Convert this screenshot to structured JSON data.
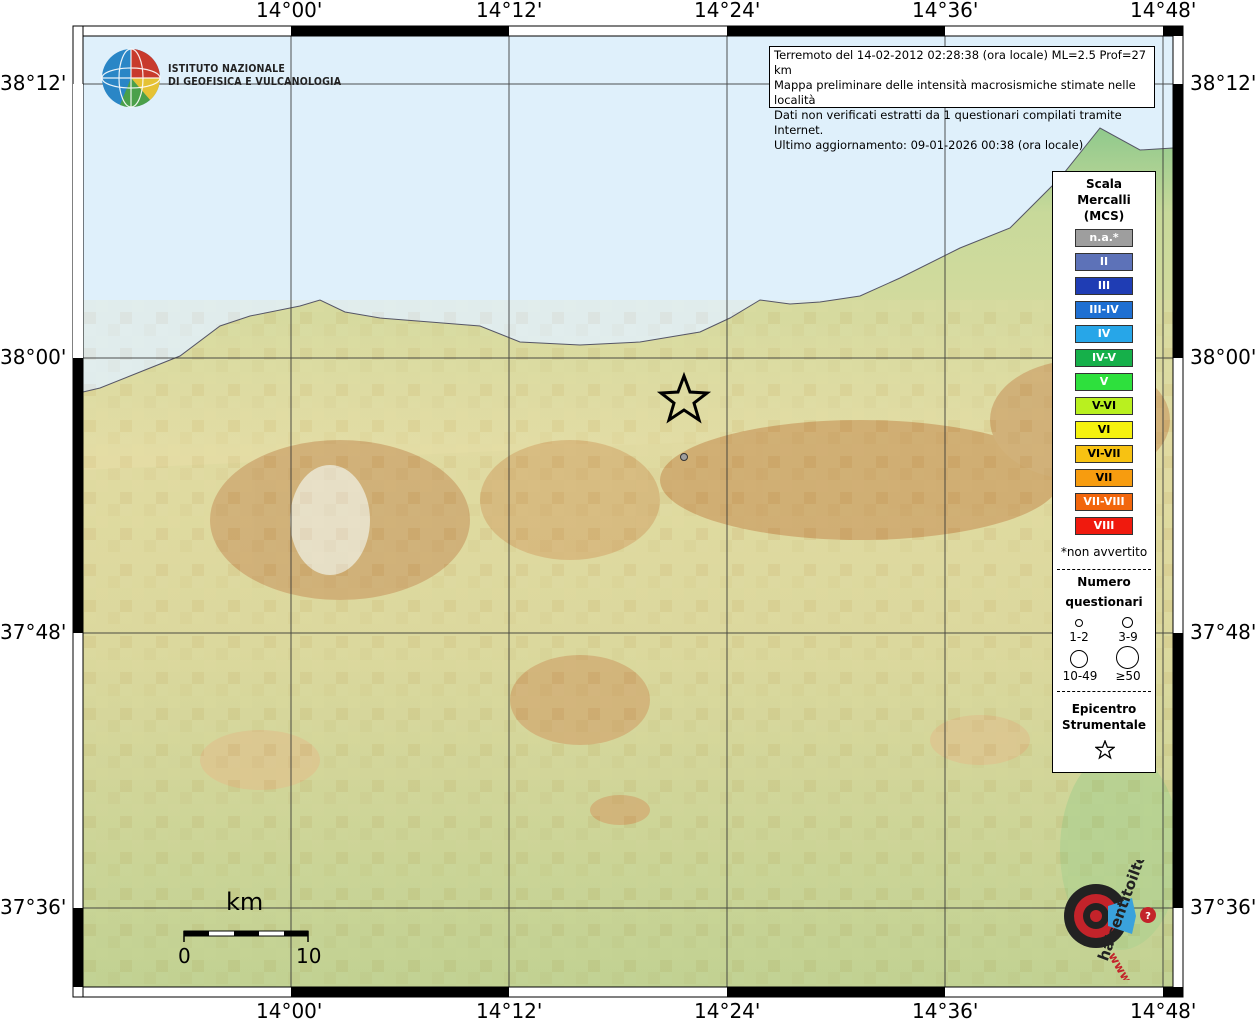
{
  "map": {
    "lon_labels": [
      "14°00'",
      "14°12'",
      "14°24'",
      "14°36'",
      "14°48'"
    ],
    "lat_labels": [
      "38°12'",
      "38°00'",
      "37°48'",
      "37°36'"
    ]
  },
  "logo": {
    "line1": "ISTITUTO NAZIONALE",
    "line2": "DI GEOFISICA E VULCANOLOGIA"
  },
  "info": {
    "line1": "Terremoto del 14-02-2012 02:28:38 (ora locale) ML=2.5 Prof=27 km",
    "line2": "Mappa preliminare delle intensità macrosismiche stimate nelle località",
    "line3": "Dati non verificati estratti da 1 questionari compilati tramite Internet.",
    "line4": "Ultimo aggiornamento: 09-01-2026 00:38 (ora locale)"
  },
  "legend": {
    "title1": "Scala",
    "title2": "Mercalli",
    "title3": "(MCS)",
    "scale": [
      {
        "label": "n.a.*",
        "color": "#9e9e9e"
      },
      {
        "label": "II",
        "color": "#5d72b8"
      },
      {
        "label": "III",
        "color": "#1f3db4"
      },
      {
        "label": "III-IV",
        "color": "#1e6fd2"
      },
      {
        "label": "IV",
        "color": "#27a6e8"
      },
      {
        "label": "IV-V",
        "color": "#16b04a"
      },
      {
        "label": "V",
        "color": "#2ee03d"
      },
      {
        "label": "V-VI",
        "color": "#b9f01f"
      },
      {
        "label": "VI",
        "color": "#f5f20e"
      },
      {
        "label": "VI-VII",
        "color": "#f7c212"
      },
      {
        "label": "VII",
        "color": "#f79c0f"
      },
      {
        "label": "VII-VIII",
        "color": "#f2660c"
      },
      {
        "label": "VIII",
        "color": "#f01a0e"
      }
    ],
    "note": "*non avvertito",
    "count_title1": "Numero",
    "count_title2": "questionari",
    "counts": [
      "1-2",
      "3-9",
      "10-49",
      "≥50"
    ],
    "epi_title1": "Epicentro",
    "epi_title2": "Strumentale"
  },
  "scalebar": {
    "unit": "km",
    "start": "0",
    "end": "10"
  },
  "brand": {
    "text": "haisentitoilterremoto.it",
    "www": "www."
  }
}
